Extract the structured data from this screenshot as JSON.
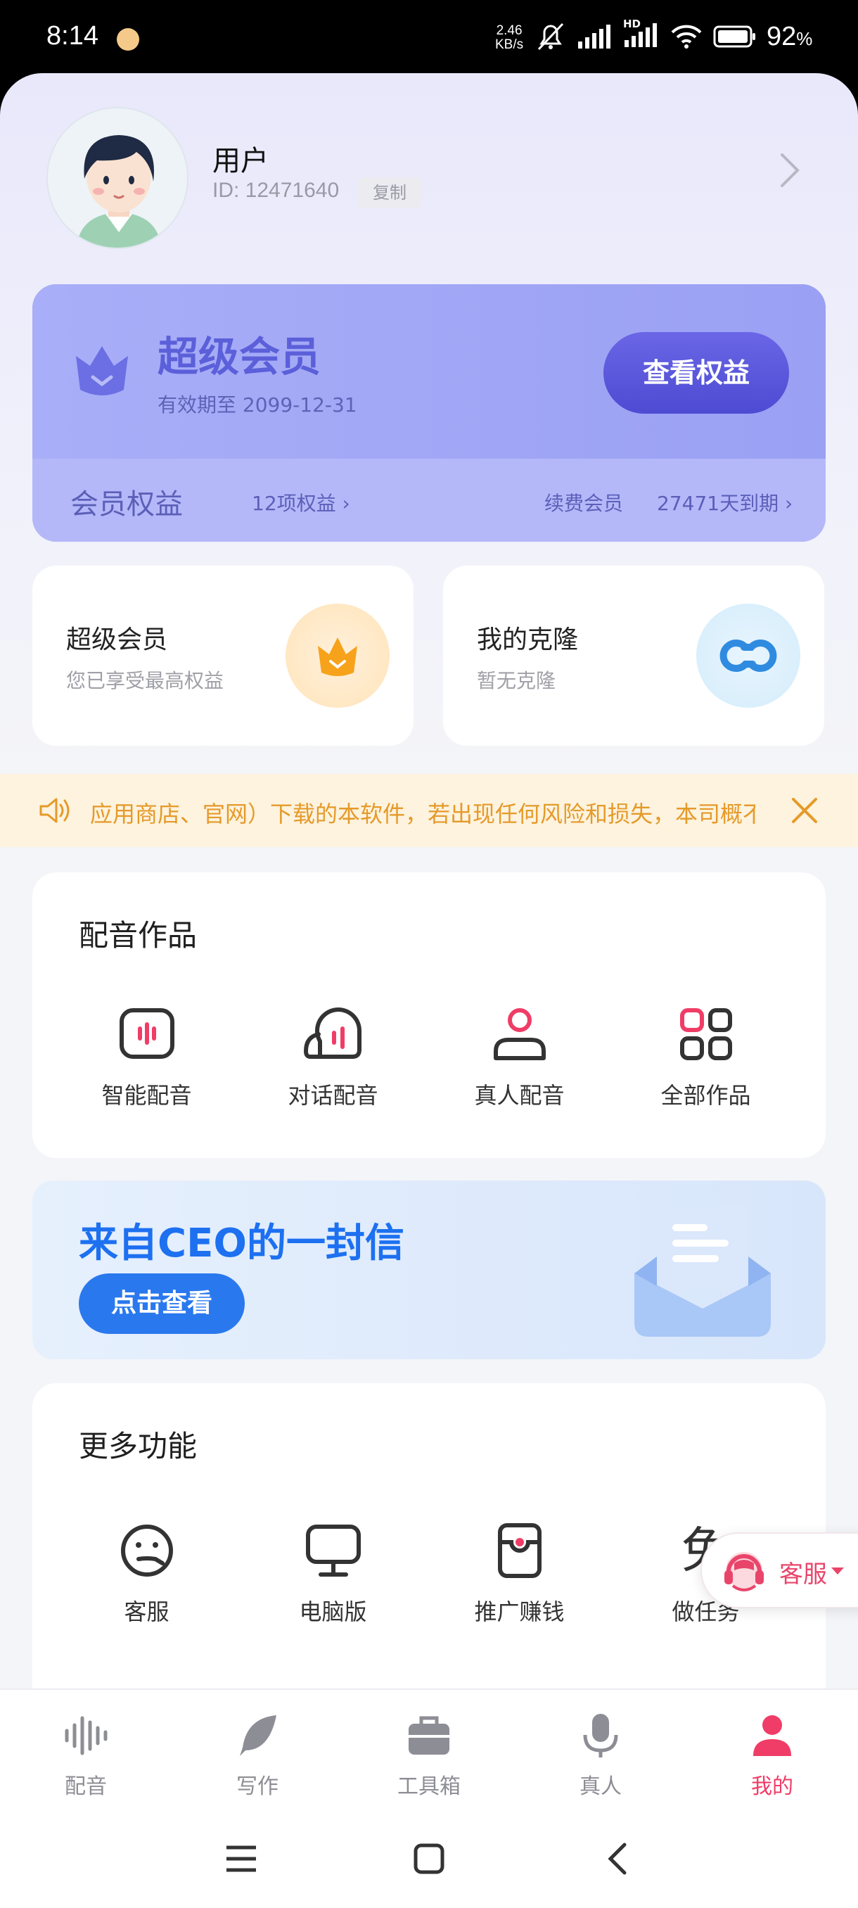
{
  "status_bar": {
    "time": "8:14",
    "net_speed_value": "2.46",
    "net_speed_unit": "KB/s",
    "battery": "92",
    "battery_unit": "%",
    "hd_label": "HD"
  },
  "profile": {
    "username": "用户",
    "user_id": "ID: 12471640",
    "copy_label": "复制"
  },
  "vip": {
    "title": "超级会员",
    "expiry": "有效期至 2099-12-31",
    "view_rights_button": "查看权益",
    "rights_title": "会员权益",
    "rights_count": "12项权益",
    "renew_label": "续费会员",
    "days_left": "27471天到期"
  },
  "mini_cards": [
    {
      "title": "超级会员",
      "subtitle": "您已享受最高权益",
      "icon": "crown-icon"
    },
    {
      "title": "我的克隆",
      "subtitle": "暂无克隆",
      "icon": "clone-link-icon"
    }
  ],
  "notice": {
    "text": "应用商店、官网）下载的本软件，若出现任何风险和损失，本司概不"
  },
  "works": {
    "title": "配音作品",
    "items": [
      {
        "label": "智能配音",
        "icon": "smart-dubbing-icon"
      },
      {
        "label": "对话配音",
        "icon": "dialogue-dubbing-icon"
      },
      {
        "label": "真人配音",
        "icon": "human-dubbing-icon"
      },
      {
        "label": "全部作品",
        "icon": "all-works-icon"
      }
    ]
  },
  "ceo_banner": {
    "title": "来自CEO的一封信",
    "button": "点击查看"
  },
  "more": {
    "title": "更多功能",
    "items": [
      {
        "label": "客服",
        "icon": "customer-service-icon"
      },
      {
        "label": "电脑版",
        "icon": "desktop-icon"
      },
      {
        "label": "推广赚钱",
        "icon": "promote-earn-icon"
      },
      {
        "label": "做任务",
        "icon": "task-icon"
      }
    ],
    "task_glyph": "免"
  },
  "float_service": {
    "label": "客服"
  },
  "tabs": [
    {
      "label": "配音",
      "icon": "waveform-icon",
      "active": false
    },
    {
      "label": "写作",
      "icon": "feather-icon",
      "active": false
    },
    {
      "label": "工具箱",
      "icon": "toolbox-icon",
      "active": false
    },
    {
      "label": "真人",
      "icon": "microphone-icon",
      "active": false
    },
    {
      "label": "我的",
      "icon": "person-icon",
      "active": true
    }
  ],
  "colors": {
    "accent_pink": "#ef3d67",
    "vip_purple": "#5b5fd9",
    "ceo_blue": "#1d70f0",
    "notice_orange": "#e59a2a"
  }
}
